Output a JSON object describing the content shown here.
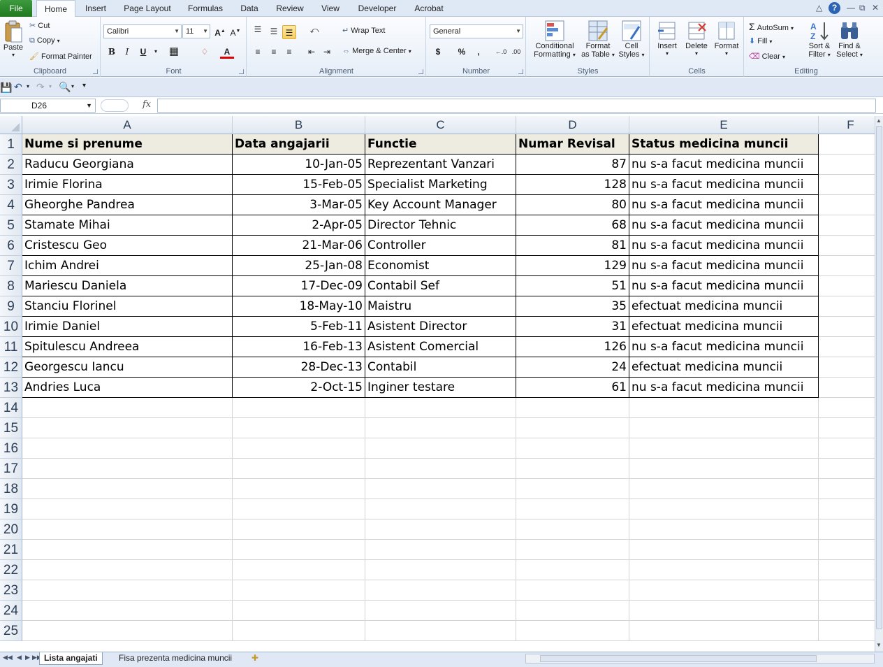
{
  "ribbon": {
    "tabs": [
      "File",
      "Home",
      "Insert",
      "Page Layout",
      "Formulas",
      "Data",
      "Review",
      "View",
      "Developer",
      "Acrobat"
    ],
    "clipboard": {
      "label": "Clipboard",
      "paste": "Paste",
      "cut": "Cut",
      "copy": "Copy",
      "format_painter": "Format Painter"
    },
    "font": {
      "label": "Font",
      "name": "Calibri",
      "size": "11",
      "bold": "B",
      "italic": "I",
      "underline": "U"
    },
    "alignment": {
      "label": "Alignment",
      "wrap_text": "Wrap Text",
      "merge_center": "Merge & Center"
    },
    "number": {
      "label": "Number",
      "format": "General",
      "currency": "$",
      "percent": "%",
      "comma": ","
    },
    "styles": {
      "label": "Styles",
      "conditional": "Conditional",
      "formatting": "Formatting",
      "format": "Format",
      "as_table": "as Table",
      "cell": "Cell",
      "cell_styles": "Styles"
    },
    "cells": {
      "label": "Cells",
      "insert": "Insert",
      "delete": "Delete",
      "format": "Format"
    },
    "editing": {
      "label": "Editing",
      "autosum": "AutoSum",
      "fill": "Fill",
      "clear": "Clear",
      "sort": "Sort &",
      "filter": "Filter",
      "find": "Find &",
      "select": "Select"
    }
  },
  "formula_bar": {
    "name_box": "D26",
    "fx": "fx",
    "value": ""
  },
  "columns": [
    "A",
    "B",
    "C",
    "D",
    "E",
    "F"
  ],
  "rows": [
    {
      "n": "1",
      "a": "Nume si prenume",
      "b": "Data angajarii",
      "c": "Functie",
      "d": "Numar Revisal",
      "e": "Status medicina muncii"
    },
    {
      "n": "2",
      "a": "Raducu Georgiana",
      "b": "10-Jan-05",
      "c": "Reprezentant Vanzari",
      "d": "87",
      "e": "nu s-a facut medicina muncii"
    },
    {
      "n": "3",
      "a": "Irimie Florina",
      "b": "15-Feb-05",
      "c": "Specialist Marketing",
      "d": "128",
      "e": "nu s-a facut medicina muncii"
    },
    {
      "n": "4",
      "a": "Gheorghe Pandrea",
      "b": "3-Mar-05",
      "c": "Key Account Manager",
      "d": "80",
      "e": "nu s-a facut medicina muncii"
    },
    {
      "n": "5",
      "a": "Stamate Mihai",
      "b": "2-Apr-05",
      "c": "Director Tehnic",
      "d": "68",
      "e": "nu s-a facut medicina muncii"
    },
    {
      "n": "6",
      "a": "Cristescu Geo",
      "b": "21-Mar-06",
      "c": "Controller",
      "d": "81",
      "e": "nu s-a facut medicina muncii"
    },
    {
      "n": "7",
      "a": "Ichim Andrei",
      "b": "25-Jan-08",
      "c": "Economist",
      "d": "129",
      "e": "nu s-a facut medicina muncii"
    },
    {
      "n": "8",
      "a": "Mariescu Daniela",
      "b": "17-Dec-09",
      "c": "Contabil Sef",
      "d": "51",
      "e": "nu s-a facut medicina muncii"
    },
    {
      "n": "9",
      "a": "Stanciu Florinel",
      "b": "18-May-10",
      "c": "Maistru",
      "d": "35",
      "e": "efectuat medicina muncii"
    },
    {
      "n": "10",
      "a": "Irimie Daniel",
      "b": "5-Feb-11",
      "c": "Asistent Director",
      "d": "31",
      "e": "efectuat medicina muncii"
    },
    {
      "n": "11",
      "a": "Spitulescu Andreea",
      "b": "16-Feb-13",
      "c": "Asistent Comercial",
      "d": "126",
      "e": "nu s-a facut medicina muncii"
    },
    {
      "n": "12",
      "a": "Georgescu Iancu",
      "b": "28-Dec-13",
      "c": "Contabil",
      "d": "24",
      "e": "efectuat medicina muncii"
    },
    {
      "n": "13",
      "a": "Andries Luca",
      "b": "2-Oct-15",
      "c": "Inginer testare",
      "d": "61",
      "e": "nu s-a facut medicina muncii"
    }
  ],
  "empty_rows": [
    "14",
    "15",
    "16",
    "17",
    "18",
    "19",
    "20",
    "21",
    "22",
    "23",
    "24",
    "25"
  ],
  "sheet_tabs": [
    "Lista angajati",
    "Fisa prezenta medicina muncii"
  ],
  "colors": {
    "header_fill": "#eeece1",
    "file_tab": "#2e7d32",
    "ribbon_bg": "#dfe9f5"
  }
}
